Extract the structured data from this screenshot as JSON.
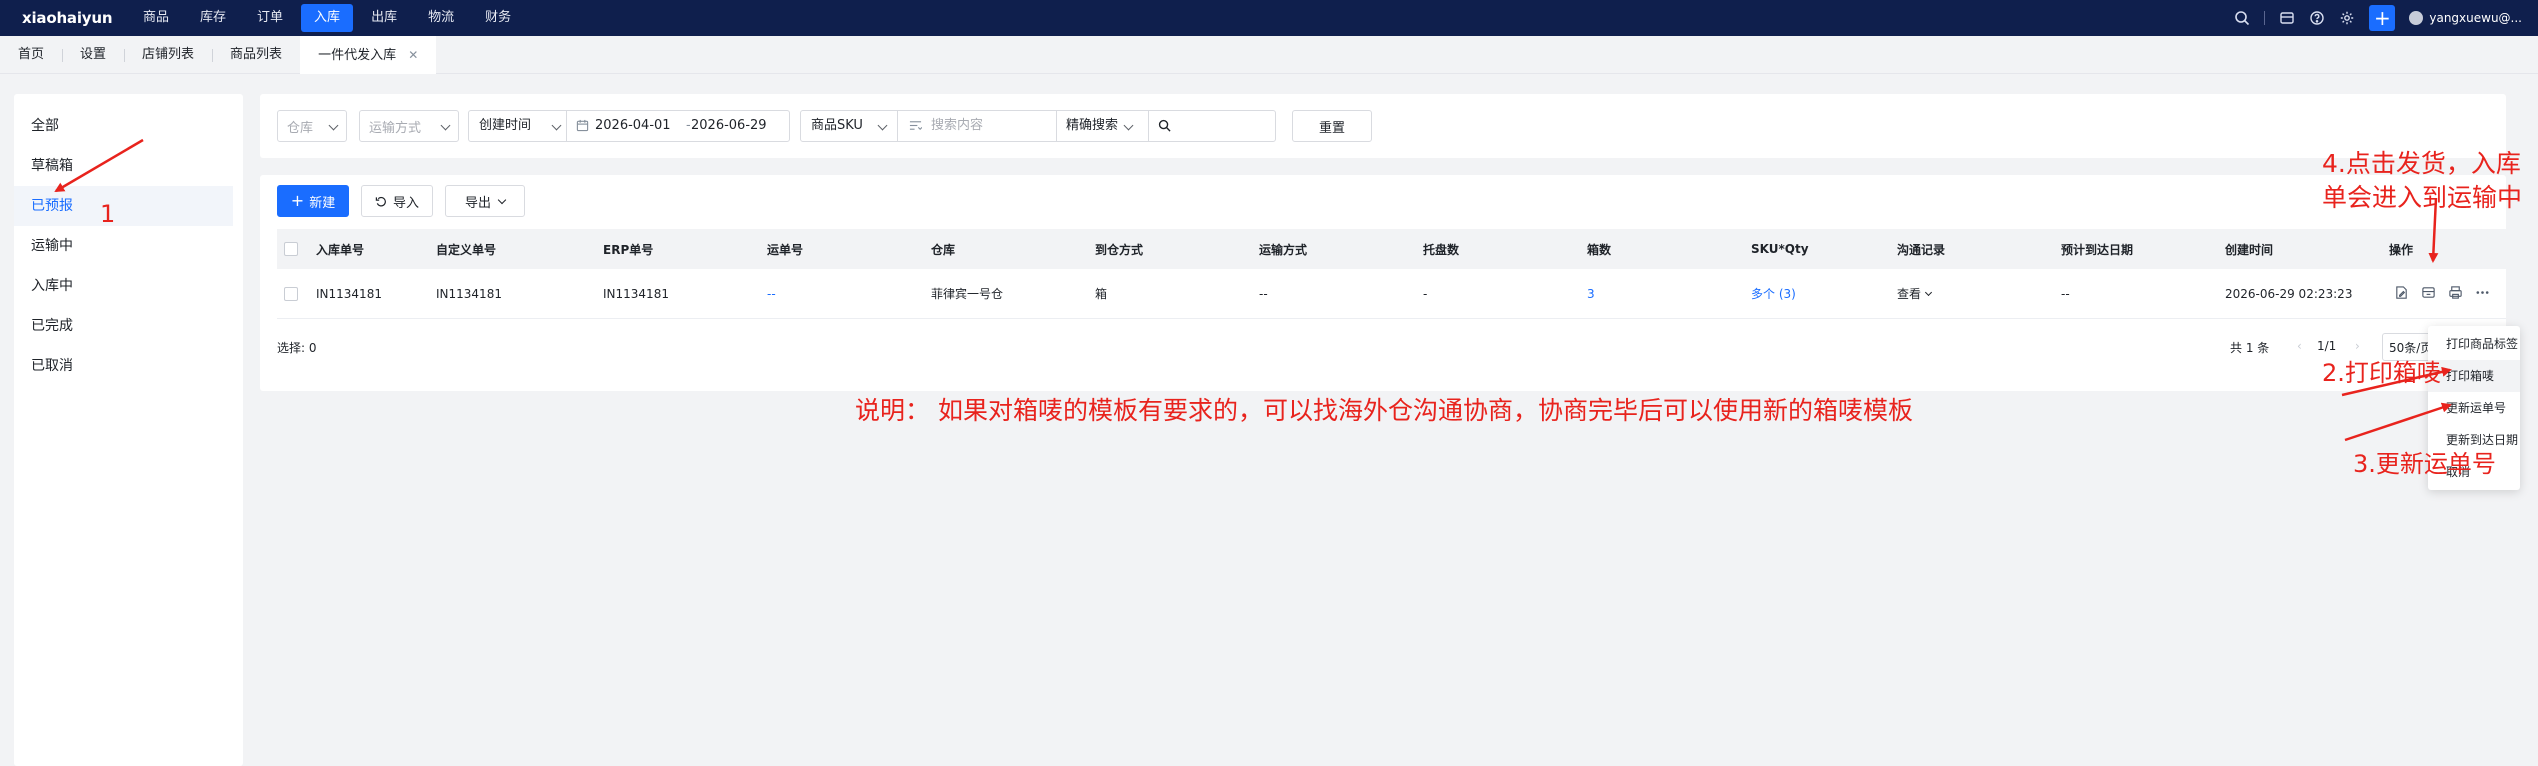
{
  "topnav": {
    "logo": "xiaohaiyun",
    "items": [
      "商品",
      "库存",
      "订单",
      "入库",
      "出库",
      "物流",
      "财务"
    ],
    "active_item": "入库",
    "user_name": "yangxuewu@...",
    "accent_color": "#1a6dff",
    "bg_color": "#0f1f4d"
  },
  "tabs": {
    "items": [
      "首页",
      "设置",
      "店铺列表",
      "商品列表",
      "一件代发入库"
    ],
    "close_glyph": "✕"
  },
  "sidebar": {
    "items": [
      "全部",
      "草稿箱",
      "已预报",
      "运输中",
      "入库中",
      "已完成",
      "已取消"
    ],
    "active_item": "已预报"
  },
  "filters": {
    "warehouse": "仓库",
    "shipping_method": "运输方式",
    "date_type": "创建时间",
    "date_start": "2026-04-01",
    "date_sep": "-",
    "date_end": "2026-06-29",
    "search_field": "商品SKU",
    "search_placeholder": "搜索内容",
    "match_mode": "精确搜索",
    "reset_label": "重置"
  },
  "toolbar": {
    "new_label": "新建",
    "import_label": "导入",
    "export_label": "导出"
  },
  "table": {
    "columns": [
      "入库单号",
      "自定义单号",
      "ERP单号",
      "运单号",
      "仓库",
      "到仓方式",
      "运输方式",
      "托盘数",
      "箱数",
      "SKU*Qty",
      "沟通记录",
      "预计到达日期",
      "创建时间",
      "操作"
    ],
    "rows": [
      {
        "inbound_no": "IN1134181",
        "custom_no": "IN1134181",
        "erp_no": "IN1134181",
        "waybill_no": "--",
        "warehouse": "菲律宾一号仓",
        "arrival_method": "箱",
        "shipping_method": "--",
        "pallets": "-",
        "boxes": "3",
        "sku_qty": "多个 (3)",
        "communication": "查看",
        "eta": "--",
        "created_at": "2026-06-29 02:23:23"
      }
    ],
    "selected_label": "选择: 0",
    "total_label": "共 1 条",
    "page_label": "1/1",
    "page_size": "50条/页"
  },
  "dropdown_menu": {
    "items": [
      "打印商品标签",
      "打印箱唛",
      "更新运单号",
      "更新到达日期",
      "取消"
    ]
  },
  "annotations": {
    "label_1": "1",
    "label_2": "2.打印箱唛",
    "label_3": "3.更新运单号",
    "label_4": "4.点击发货，入库单会进入到运输中",
    "note": "说明：  如果对箱唛的模板有要求的，可以找海外仓沟通协商，协商完毕后可以使用新的箱唛模板",
    "color": "#e8231d"
  }
}
